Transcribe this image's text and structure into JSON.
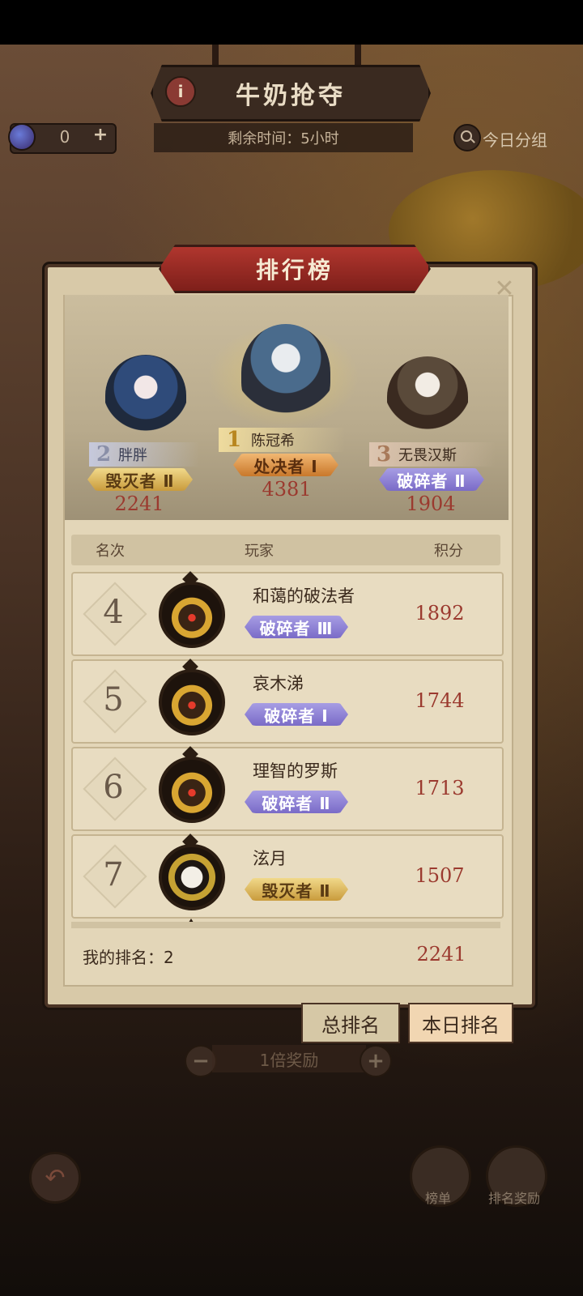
{
  "header": {
    "title": "牛奶抢夺",
    "info_icon": "i",
    "currency_value": "0",
    "currency_plus": "+",
    "remaining_time": "剩余时间：5小时",
    "group_button": "今日分组"
  },
  "panel": {
    "title": "排行榜",
    "close_icon": "✕",
    "podium": [
      {
        "rank": "2",
        "name": "胖胖",
        "badge": "毁灭者 Ⅱ",
        "score": "2241"
      },
      {
        "rank": "1",
        "name": "陈冠希",
        "badge": "处决者 Ⅰ",
        "score": "4381"
      },
      {
        "rank": "3",
        "name": "无畏汉斯",
        "badge": "破碎者 Ⅱ",
        "score": "1904"
      }
    ],
    "table_headers": {
      "rank": "名次",
      "player": "玩家",
      "score": "积分"
    },
    "rows": [
      {
        "rank": "4",
        "name": "和蔼的破法者",
        "badge": "破碎者 Ⅲ",
        "score": "1892"
      },
      {
        "rank": "5",
        "name": "哀木涕",
        "badge": "破碎者 Ⅰ",
        "score": "1744"
      },
      {
        "rank": "6",
        "name": "理智的罗斯",
        "badge": "破碎者 Ⅱ",
        "score": "1713"
      },
      {
        "rank": "7",
        "name": "泫月",
        "badge": "毁灭者 Ⅱ",
        "score": "1507"
      }
    ],
    "my_rank_label": "我的排名：2",
    "my_score": "2241"
  },
  "tabs": {
    "total": "总排名",
    "today": "本日排名"
  },
  "reward": {
    "minus": "−",
    "label": "1倍奖励",
    "plus": "+"
  },
  "bottom": {
    "back_icon": "↶",
    "leaderboard_label": "榜单",
    "rank_reward_label": "排名奖励"
  },
  "colors": {
    "accent_red": "#9b3a2f",
    "purple_badge": "#7a6bc7",
    "gold_badge": "#c99b3c",
    "orange_badge": "#c9782b"
  }
}
